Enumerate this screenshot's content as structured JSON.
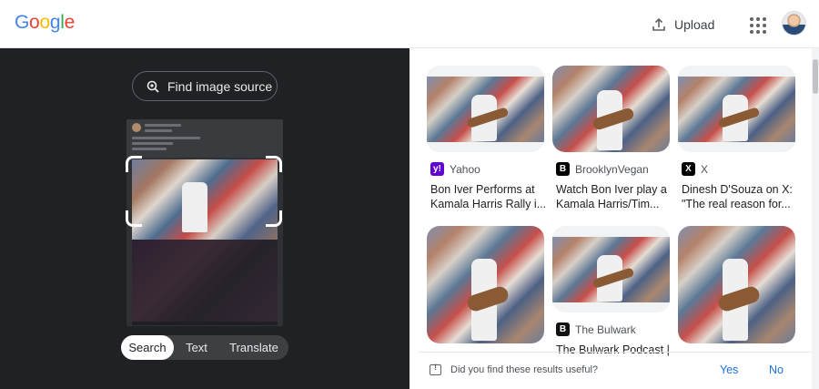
{
  "header": {
    "logo_letters": [
      "G",
      "o",
      "o",
      "g",
      "l",
      "e"
    ],
    "logo_colors": [
      "#4285f4",
      "#ea4335",
      "#fbbc05",
      "#4285f4",
      "#34a853",
      "#ea4335"
    ],
    "upload_label": "Upload"
  },
  "left_panel": {
    "find_source_label": "Find image source",
    "tabs": [
      {
        "label": "Search",
        "active": true
      },
      {
        "label": "Text",
        "active": false
      },
      {
        "label": "Translate",
        "active": false
      }
    ]
  },
  "results": [
    {
      "source": "Yahoo",
      "source_icon": "yahoo-icon",
      "icon_color": "#6001d2",
      "icon_glyph": "y!",
      "title_line1": "Bon Iver Performs at",
      "title_line2": "Kamala Harris Rally i..."
    },
    {
      "source": "BrooklynVegan",
      "source_icon": "brooklynvegan-icon",
      "icon_color": "#000000",
      "icon_glyph": "B",
      "title_line1": "Watch Bon Iver play a",
      "title_line2": "Kamala Harris/Tim..."
    },
    {
      "source": "X",
      "source_icon": "x-icon",
      "icon_color": "#000000",
      "icon_glyph": "X",
      "title_line1": "Dinesh D'Souza on X:",
      "title_line2": "\"The real reason for..."
    },
    {
      "source": "",
      "title_line1": "",
      "title_line2": ""
    },
    {
      "source": "The Bulwark",
      "source_icon": "bulwark-icon",
      "icon_color": "#111111",
      "icon_glyph": "B",
      "title_line1": "The Bulwark Podcast |",
      "title_line2": ""
    },
    {
      "source": "",
      "title_line1": "",
      "title_line2": ""
    }
  ],
  "feedback": {
    "question": "Did you find these results useful?",
    "yes_label": "Yes",
    "no_label": "No"
  }
}
